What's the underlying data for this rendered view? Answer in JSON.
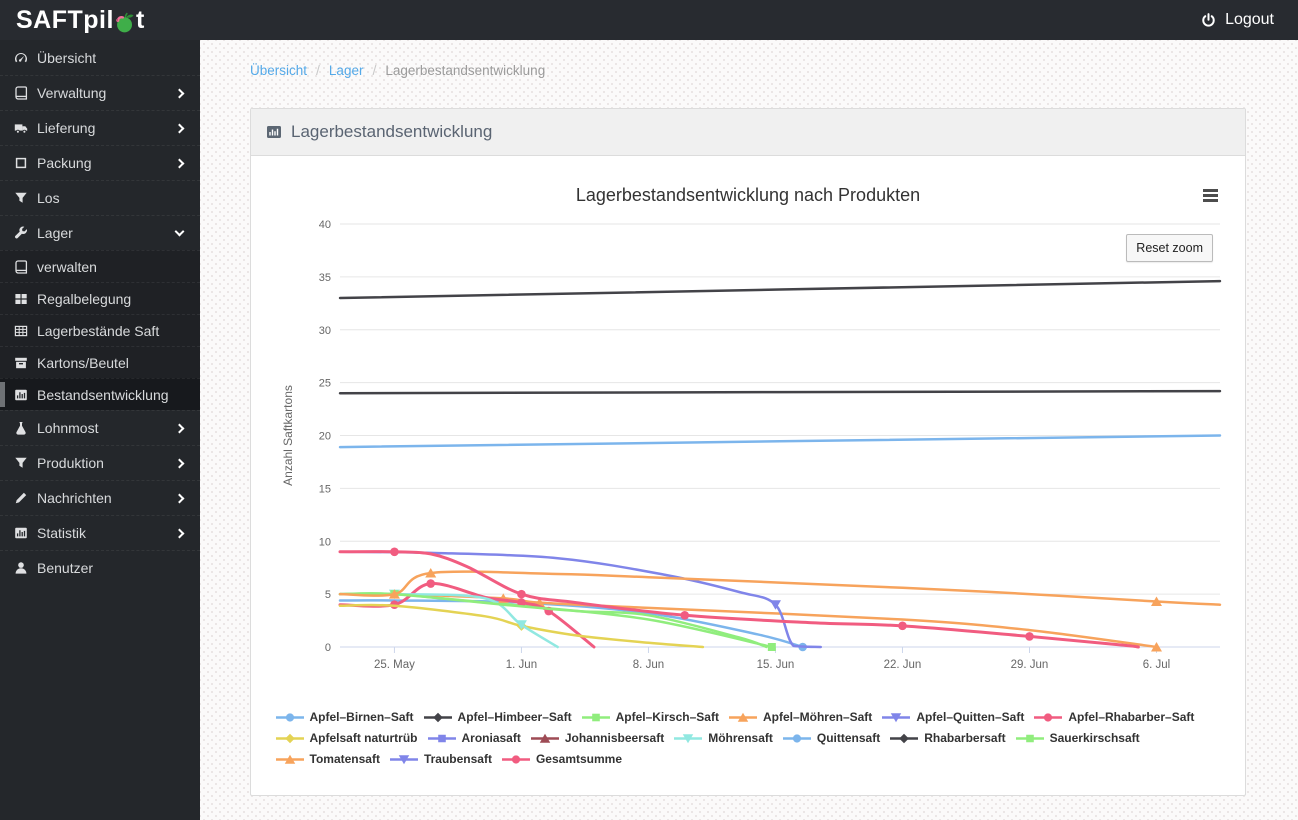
{
  "topbar": {
    "logo_prefix": "SAFTpil",
    "logo_suffix": "t",
    "logo_icon": "apple-worm-icon",
    "logout_label": "Logout",
    "logout_icon": "power-icon"
  },
  "sidebar": {
    "items": [
      {
        "key": "uebersicht",
        "label": "Übersicht",
        "icon": "gauge-icon"
      },
      {
        "key": "verwaltung",
        "label": "Verwaltung",
        "icon": "book-icon",
        "chevron": "right"
      },
      {
        "key": "lieferung",
        "label": "Lieferung",
        "icon": "truck-icon",
        "chevron": "right"
      },
      {
        "key": "packung",
        "label": "Packung",
        "icon": "box-icon",
        "chevron": "right"
      },
      {
        "key": "los",
        "label": "Los",
        "icon": "filter-icon"
      },
      {
        "key": "lager",
        "label": "Lager",
        "icon": "wrench-icon",
        "chevron": "down"
      },
      {
        "key": "verwalten",
        "label": "verwalten",
        "icon": "book-icon",
        "sub": true
      },
      {
        "key": "regalbelegung",
        "label": "Regalbelegung",
        "icon": "grid-icon",
        "sub": true
      },
      {
        "key": "lagerbestaende-saft",
        "label": "Lagerbestände Saft",
        "icon": "table-icon",
        "sub": true
      },
      {
        "key": "kartons-beutel",
        "label": "Kartons/Beutel",
        "icon": "archive-icon",
        "sub": true
      },
      {
        "key": "bestandsentwicklung",
        "label": "Bestandsentwicklung",
        "icon": "bar-chart-icon",
        "sub": true,
        "active": true
      },
      {
        "key": "lohnmost",
        "label": "Lohnmost",
        "icon": "flask-icon",
        "chevron": "right"
      },
      {
        "key": "produktion",
        "label": "Produktion",
        "icon": "filter-icon",
        "chevron": "right"
      },
      {
        "key": "nachrichten",
        "label": "Nachrichten",
        "icon": "pencil-icon",
        "chevron": "right"
      },
      {
        "key": "statistik",
        "label": "Statistik",
        "icon": "bar-chart-icon",
        "chevron": "right"
      },
      {
        "key": "benutzer",
        "label": "Benutzer",
        "icon": "user-icon"
      }
    ]
  },
  "breadcrumb": {
    "items": [
      {
        "label": "Übersicht",
        "link": true
      },
      {
        "label": "Lager",
        "link": true
      },
      {
        "label": "Lagerbestandsentwicklung",
        "link": false
      }
    ]
  },
  "panel": {
    "title": "Lagerbestandsentwicklung",
    "icon": "bar-chart-icon"
  },
  "chart_data": {
    "type": "line",
    "title": "Lagerbestandsentwicklung nach Produkten",
    "ylabel": "Anzahl Saftkartons",
    "ylim": [
      0,
      40
    ],
    "ytick_step": 5,
    "x_unit": "days_since_22_may",
    "xlim": [
      0,
      48.5
    ],
    "xticks": [
      {
        "day": 3,
        "label": "25. May"
      },
      {
        "day": 10,
        "label": "1. Jun"
      },
      {
        "day": 17,
        "label": "8. Jun"
      },
      {
        "day": 24,
        "label": "15. Jun"
      },
      {
        "day": 31,
        "label": "22. Jun"
      },
      {
        "day": 38,
        "label": "29. Jun"
      },
      {
        "day": 45,
        "label": "6. Jul"
      }
    ],
    "grid": true,
    "legend_position": "bottom",
    "reset_zoom_label": "Reset zoom",
    "menu_icon": "hamburger-icon",
    "colors": {
      "blue": "#7cb5ec",
      "black": "#434348",
      "green": "#90ed7d",
      "orange": "#f7a35c",
      "lavender": "#8085e9",
      "pink": "#f15c80",
      "yellow": "#e4d354",
      "maroon": "#9e4b55",
      "teal": "#91e8e1"
    },
    "series": [
      {
        "name": "Apfel–Birnen–Saft",
        "color": "#7cb5ec",
        "marker": "circle",
        "points": [
          [
            0,
            4.4
          ],
          [
            3,
            4.4
          ],
          [
            10,
            4.2
          ],
          [
            17,
            3.2
          ],
          [
            23,
            1.2
          ],
          [
            25.5,
            0,
            1
          ]
        ]
      },
      {
        "name": "Apfel–Himbeer–Saft",
        "color": "#434348",
        "marker": "diamond",
        "points": [
          [
            0,
            33
          ],
          [
            48.5,
            34.6
          ]
        ]
      },
      {
        "name": "Apfel–Kirsch–Saft",
        "color": "#90ed7d",
        "marker": "square",
        "points": [
          [
            0,
            5
          ],
          [
            3,
            5
          ],
          [
            8,
            4.2
          ],
          [
            10,
            3.9
          ],
          [
            17,
            2.6
          ],
          [
            23.8,
            0,
            1
          ]
        ]
      },
      {
        "name": "Apfel–Möhren–Saft",
        "color": "#f7a35c",
        "marker": "triangle",
        "points": [
          [
            0,
            5
          ],
          [
            3,
            5
          ],
          [
            9,
            4.6,
            1
          ],
          [
            11,
            4.2,
            1
          ],
          [
            17,
            3.7
          ],
          [
            31,
            2.6
          ],
          [
            38,
            1.6
          ],
          [
            45,
            0,
            1
          ]
        ]
      },
      {
        "name": "Apfel–Quitten–Saft",
        "color": "#8085e9",
        "marker": "triangle-down",
        "points": [
          [
            0,
            9
          ],
          [
            5,
            8.9
          ],
          [
            12,
            8.4
          ],
          [
            18,
            6.8
          ],
          [
            22,
            5.2
          ],
          [
            24,
            4,
            1
          ],
          [
            25,
            0.1
          ],
          [
            26.5,
            0
          ]
        ]
      },
      {
        "name": "Apfel–Rhabarber–Saft",
        "color": "#f15c80",
        "marker": "circle",
        "width": 3,
        "points": [
          [
            0,
            4
          ],
          [
            3,
            4,
            1
          ],
          [
            5,
            6,
            1
          ],
          [
            8,
            4.7
          ],
          [
            10,
            4.2,
            1
          ],
          [
            11.5,
            3.4,
            1
          ],
          [
            14,
            0
          ]
        ]
      },
      {
        "name": "Apfelsaft naturtrüb",
        "color": "#e4d354",
        "marker": "diamond",
        "points": [
          [
            0,
            3.9
          ],
          [
            3,
            3.9
          ],
          [
            8,
            2.9
          ],
          [
            10,
            2,
            1
          ],
          [
            13,
            1.1
          ],
          [
            17,
            0.4
          ],
          [
            20,
            0
          ]
        ]
      },
      {
        "name": "Aroniasaft",
        "color": "#8085e9",
        "marker": "square",
        "points": [
          [
            0,
            0
          ]
        ]
      },
      {
        "name": "Johannisbeersaft",
        "color": "#9e4b55",
        "marker": "triangle",
        "points": [
          [
            0,
            0
          ]
        ]
      },
      {
        "name": "Möhrensaft",
        "color": "#91e8e1",
        "marker": "triangle-down",
        "points": [
          [
            0,
            5
          ],
          [
            3,
            5,
            1
          ],
          [
            8,
            4.6
          ],
          [
            10,
            2.1,
            1
          ],
          [
            12,
            0
          ]
        ]
      },
      {
        "name": "Quittensaft",
        "color": "#7cb5ec",
        "marker": "circle",
        "points": [
          [
            0,
            18.9
          ],
          [
            48.5,
            20
          ]
        ]
      },
      {
        "name": "Rhabarbersaft",
        "color": "#434348",
        "marker": "diamond",
        "points": [
          [
            0,
            24
          ],
          [
            48.5,
            24.2
          ]
        ]
      },
      {
        "name": "Sauerkirschsaft",
        "color": "#90ed7d",
        "marker": "square",
        "points": [
          [
            0,
            5
          ],
          [
            3,
            5,
            1
          ],
          [
            9,
            4
          ],
          [
            13,
            3.4
          ],
          [
            17,
            3
          ],
          [
            22,
            0.9
          ],
          [
            23.5,
            0
          ]
        ]
      },
      {
        "name": "Tomatensaft",
        "color": "#f7a35c",
        "marker": "triangle",
        "points": [
          [
            0,
            5
          ],
          [
            3,
            5,
            1
          ],
          [
            5,
            7,
            1
          ],
          [
            12,
            6.9
          ],
          [
            17,
            6.6
          ],
          [
            31,
            5.6
          ],
          [
            38,
            5
          ],
          [
            45,
            4.3,
            1
          ],
          [
            48.5,
            4
          ]
        ]
      },
      {
        "name": "Traubensaft",
        "color": "#8085e9",
        "marker": "triangle-down",
        "points": [
          [
            0,
            0
          ]
        ]
      },
      {
        "name": "Gesamtsumme",
        "color": "#f15c80",
        "marker": "circle",
        "width": 3,
        "points": [
          [
            0,
            9
          ],
          [
            3,
            9,
            1
          ],
          [
            5,
            8.8
          ],
          [
            7,
            7.6
          ],
          [
            10,
            5,
            1
          ],
          [
            13,
            4.2
          ],
          [
            19,
            3,
            1
          ],
          [
            26,
            2.3
          ],
          [
            31,
            2,
            1
          ],
          [
            38,
            1,
            1
          ],
          [
            43,
            0.2
          ],
          [
            44,
            0
          ]
        ]
      }
    ]
  }
}
